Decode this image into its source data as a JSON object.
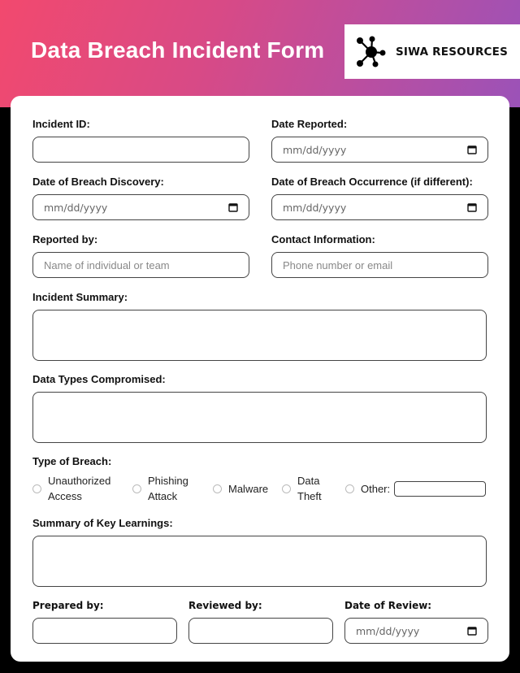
{
  "header": {
    "title": "Data Breach Incident Form",
    "brand": "SIWA RESOURCES",
    "brand_icon": "network-hub-icon",
    "gradient_colors": [
      "#f2496e",
      "#9b52b8"
    ]
  },
  "form": {
    "incident_id": {
      "label": "Incident ID:",
      "value": ""
    },
    "date_reported": {
      "label": "Date Reported:",
      "placeholder": "mm/dd/yyyy"
    },
    "date_discovery": {
      "label": "Date of Breach Discovery:",
      "placeholder": "mm/dd/yyyy"
    },
    "date_occurrence": {
      "label": "Date of Breach Occurrence (if different):",
      "placeholder": "mm/dd/yyyy"
    },
    "reported_by": {
      "label": "Reported by:",
      "placeholder": "Name of individual or team"
    },
    "contact_info": {
      "label": "Contact Information:",
      "placeholder": "Phone number or email"
    },
    "incident_summary": {
      "label": "Incident Summary:",
      "value": ""
    },
    "data_types": {
      "label": "Data Types Compromised:",
      "value": ""
    },
    "breach_type": {
      "label": "Type of Breach:",
      "options": [
        {
          "line1": "Unauthorized",
          "line2": "Access"
        },
        {
          "line1": "Phishing",
          "line2": "Attack"
        },
        {
          "line1": "Malware",
          "line2": ""
        },
        {
          "line1": "Data",
          "line2": "Theft"
        },
        {
          "line1": "Other:",
          "line2": ""
        }
      ],
      "other_value": ""
    },
    "key_learnings": {
      "label": "Summary of Key Learnings:",
      "value": ""
    },
    "prepared_by": {
      "label": "Prepared by:",
      "value": ""
    },
    "reviewed_by": {
      "label": "Reviewed by:",
      "value": ""
    },
    "date_review": {
      "label": "Date of Review:",
      "placeholder": "mm/dd/yyyy"
    }
  }
}
